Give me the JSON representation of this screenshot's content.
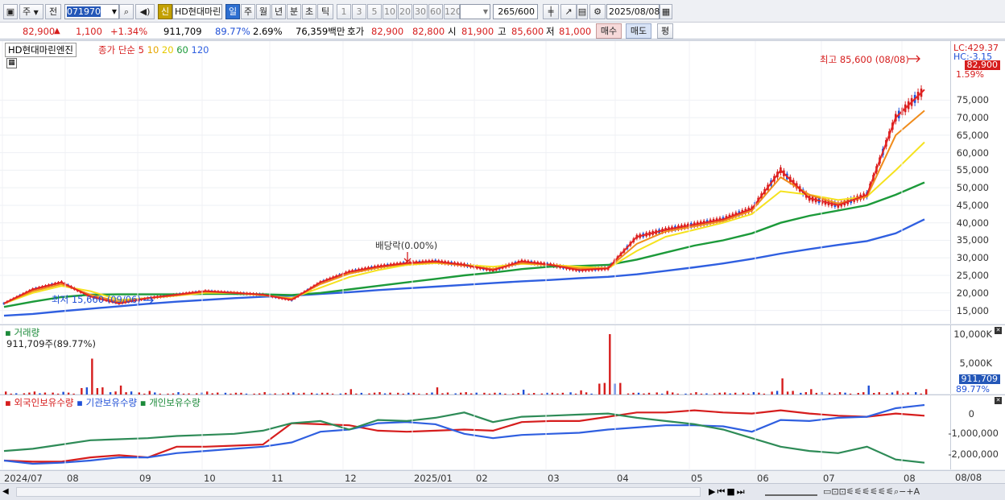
{
  "toolbar": {
    "chart_type_icon": "candlestick-window-icon",
    "period_btn": "주",
    "prev_btn": "전",
    "code": "071970",
    "search_icon": "search-icon",
    "speaker_icon": "speaker-icon",
    "new_badge": "신",
    "stock_name": "HD현대마린",
    "periods": [
      "일",
      "주",
      "월",
      "년",
      "분",
      "초",
      "틱"
    ],
    "active_period": "일",
    "ticks": [
      "1",
      "3",
      "5",
      "10",
      "20",
      "30",
      "60",
      "120"
    ],
    "count": "265",
    "count_max": "/600",
    "date": "2025/08/08"
  },
  "quote": {
    "price": "82,900",
    "change": "1,100",
    "change_pct": "+1.34%",
    "volume": "911,709",
    "vol_ratio": "89.77%",
    "turnover": "2.69%",
    "amount": "76,359백만",
    "ask_label": "호가",
    "ask": "82,900",
    "bid": "82,800",
    "open_label": "시",
    "open": "81,900",
    "high_label": "고",
    "high": "85,600",
    "low_label": "저",
    "low": "81,000",
    "buy": "매수",
    "sell": "매도",
    "flat": "평"
  },
  "price_panel": {
    "title": "HD현대마린엔진",
    "ma_label": "종가 단순",
    "ma_periods": [
      "5",
      "10",
      "20",
      "60",
      "120"
    ],
    "max_annot": "최고 85,600 (08/08)",
    "min_annot": "최저 15,660 (09/06)",
    "dividend_annot": "배당락(0.00%)",
    "lc": "LC:429.37",
    "hc": "HC:-3.15",
    "last_price": "82,900",
    "last_pct": "1.59%",
    "y_ticks": [
      "75,000",
      "70,000",
      "65,000",
      "60,000",
      "55,000",
      "50,000",
      "45,000",
      "40,000",
      "35,000",
      "30,000",
      "25,000",
      "20,000",
      "15,000"
    ]
  },
  "volume_panel": {
    "title": "거래량",
    "value": "911,709주(89.77%)",
    "y_ticks": [
      "10,000K",
      "5,000K"
    ],
    "last_vol": "911,709",
    "last_pct": "89.77%"
  },
  "holding_panel": {
    "legends": [
      "외국인보유수량",
      "기관보유수량",
      "개인보유수량"
    ],
    "y_ticks": [
      "0",
      "-1,000,000",
      "-2,000,000"
    ]
  },
  "x_axis": {
    "labels": [
      "2024/07",
      "08",
      "09",
      "10",
      "11",
      "12",
      "2025/01",
      "02",
      "03",
      "04",
      "05",
      "06",
      "07",
      "08"
    ],
    "corner": "08/08"
  },
  "colors": {
    "ma5": "#e32424",
    "ma10": "#f08c1c",
    "ma20": "#f5e21e",
    "ma60": "#1c9a3a",
    "ma120": "#2f5fe0",
    "up": "#d61d1d",
    "down": "#1f4fd6"
  },
  "chart_data": {
    "type": "candlestick",
    "ma_close": [
      {
        "name": "5",
        "values": [
          17000,
          21000,
          23000,
          19000,
          17000,
          18500,
          19500,
          20500,
          20000,
          19500,
          18000,
          23000,
          26000,
          27500,
          28500,
          29000,
          28000,
          26500,
          29000,
          28000,
          26500,
          27000,
          36000,
          38000,
          39500,
          41000,
          44000,
          55000,
          47000,
          45000,
          48000,
          70000,
          78000
        ]
      },
      {
        "name": "10",
        "values": [
          17000,
          20500,
          22500,
          19500,
          17500,
          18500,
          19300,
          20300,
          20100,
          19400,
          18300,
          22500,
          25500,
          27200,
          28300,
          28700,
          27800,
          26800,
          28500,
          28000,
          27000,
          27000,
          34000,
          37500,
          39000,
          40500,
          43500,
          53000,
          48000,
          45500,
          47500,
          65000,
          72000
        ]
      },
      {
        "name": "20",
        "values": [
          17000,
          20000,
          22000,
          20500,
          18000,
          18500,
          19200,
          20000,
          20000,
          19300,
          18500,
          21500,
          24500,
          26500,
          28000,
          28500,
          28000,
          27500,
          28300,
          28000,
          27500,
          27000,
          32000,
          36000,
          38000,
          40000,
          42500,
          49000,
          48000,
          46500,
          47500,
          55000,
          63000
        ]
      },
      {
        "name": "60",
        "values": [
          16000,
          17500,
          18800,
          19500,
          19600,
          19600,
          19600,
          19700,
          19700,
          19600,
          19400,
          20000,
          21000,
          22000,
          23000,
          24000,
          25000,
          25800,
          26800,
          27500,
          27700,
          28000,
          29500,
          31500,
          33500,
          35000,
          37000,
          40000,
          42000,
          43500,
          45000,
          48000,
          51500
        ]
      },
      {
        "name": "120",
        "values": [
          13500,
          14000,
          14800,
          15500,
          16200,
          16900,
          17500,
          18000,
          18500,
          18900,
          19200,
          19700,
          20200,
          20800,
          21300,
          21800,
          22300,
          22800,
          23300,
          23700,
          24200,
          24600,
          25300,
          26300,
          27300,
          28400,
          29700,
          31200,
          32500,
          33700,
          34800,
          37000,
          41000
        ]
      }
    ],
    "volume": [
      500,
      500,
      450,
      6000,
      1500,
      600,
      400,
      500,
      300,
      400,
      350,
      300,
      900,
      400,
      300,
      1200,
      400,
      300,
      800,
      300,
      700,
      10100,
      300,
      600,
      400,
      350,
      400,
      2700,
      900,
      400,
      1500,
      600,
      900
    ],
    "foreign": [
      -2350000,
      -2400000,
      -2400000,
      -2200000,
      -2100000,
      -2200000,
      -1700000,
      -1700000,
      -1650000,
      -1600000,
      -600000,
      -650000,
      -700000,
      -950000,
      -1000000,
      -950000,
      -900000,
      -950000,
      -550000,
      -500000,
      -500000,
      -300000,
      -100000,
      -100000,
      0,
      -100000,
      -150000,
      0,
      -150000,
      -250000,
      -300000,
      -150000,
      -250000
    ],
    "institution": [
      -2350000,
      -2500000,
      -2450000,
      -2350000,
      -2200000,
      -2200000,
      -2000000,
      -1900000,
      -1800000,
      -1700000,
      -1500000,
      -1000000,
      -900000,
      -600000,
      -550000,
      -650000,
      -1100000,
      -1300000,
      -1150000,
      -1100000,
      -1050000,
      -900000,
      -800000,
      -700000,
      -700000,
      -750000,
      -1000000,
      -450000,
      -500000,
      -350000,
      -300000,
      100000,
      250000
    ],
    "individual": [
      -1900000,
      -1800000,
      -1600000,
      -1400000,
      -1350000,
      -1300000,
      -1200000,
      -1150000,
      -1100000,
      -950000,
      -600000,
      -500000,
      -900000,
      -450000,
      -500000,
      -350000,
      -100000,
      -550000,
      -300000,
      -250000,
      -200000,
      -150000,
      -350000,
      -500000,
      -650000,
      -900000,
      -1300000,
      -1700000,
      -1900000,
      -2000000,
      -1700000,
      -2300000,
      -2450000
    ],
    "high": 85600,
    "high_date": "08/08",
    "low": 15660,
    "low_date": "09/06",
    "ylim": [
      11000,
      90000
    ],
    "x": [
      "2024/07",
      "08",
      "09",
      "10",
      "11",
      "12",
      "2025/01",
      "02",
      "03",
      "04",
      "05",
      "06",
      "07",
      "08"
    ]
  }
}
